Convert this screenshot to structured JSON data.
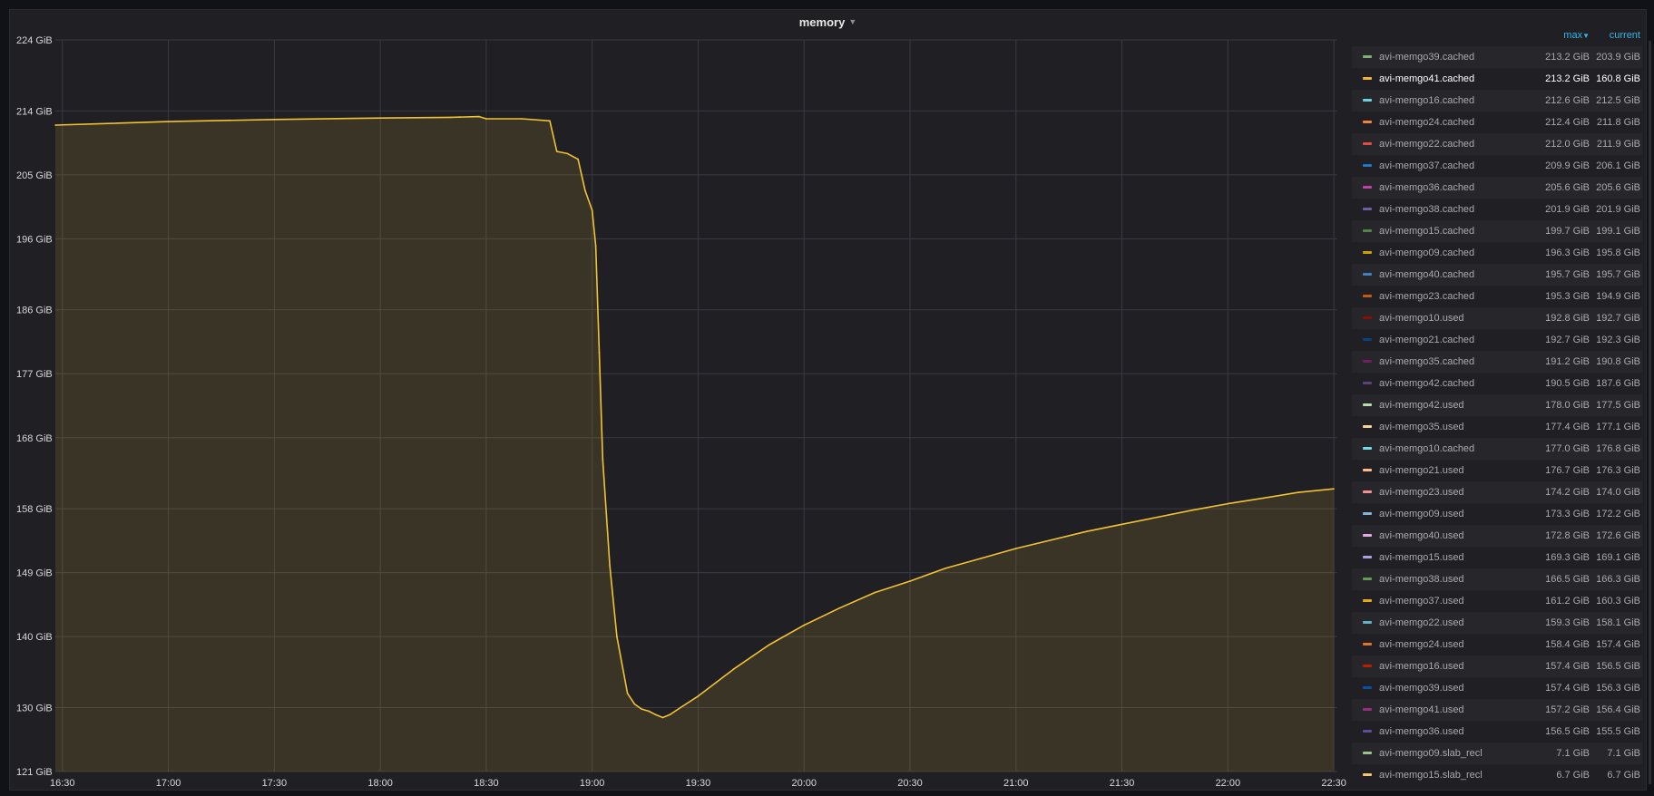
{
  "panel": {
    "title": "memory"
  },
  "chart_data": {
    "type": "area",
    "title": "memory",
    "y_unit": "GiB",
    "y_ticks": [
      "224 GiB",
      "214 GiB",
      "205 GiB",
      "196 GiB",
      "186 GiB",
      "177 GiB",
      "168 GiB",
      "158 GiB",
      "149 GiB",
      "140 GiB",
      "130 GiB",
      "121 GiB"
    ],
    "ylim": [
      121,
      224
    ],
    "x_ticks": [
      "16:30",
      "17:00",
      "17:30",
      "18:00",
      "18:30",
      "19:00",
      "19:30",
      "20:00",
      "20:30",
      "21:00",
      "21:30",
      "22:00",
      "22:30"
    ],
    "xlim_minutes": [
      988,
      1351
    ],
    "grid": true,
    "legend_placement": "right",
    "series": [
      {
        "name": "avi-memgo41.cached",
        "color": "#f2c233",
        "x": [
          "16:28",
          "17:00",
          "17:30",
          "18:00",
          "18:20",
          "18:28",
          "18:30",
          "18:40",
          "18:48",
          "18:50",
          "18:53",
          "18:56",
          "18:58",
          "19:00",
          "19:01",
          "19:02",
          "19:03",
          "19:05",
          "19:07",
          "19:10",
          "19:12",
          "19:14",
          "19:16",
          "19:18",
          "19:20",
          "19:22",
          "19:25",
          "19:30",
          "19:40",
          "19:50",
          "20:00",
          "20:10",
          "20:20",
          "20:30",
          "20:40",
          "20:50",
          "21:00",
          "21:10",
          "21:20",
          "21:30",
          "21:40",
          "21:50",
          "22:00",
          "22:10",
          "22:20",
          "22:30"
        ],
        "values": [
          212.0,
          212.5,
          212.8,
          213.0,
          213.1,
          213.2,
          212.9,
          212.9,
          212.6,
          208.3,
          208.0,
          207.2,
          202.8,
          200.0,
          195.0,
          180.0,
          165.0,
          150.0,
          140.0,
          132.0,
          130.5,
          129.8,
          129.5,
          129.0,
          128.6,
          129.0,
          130.0,
          131.6,
          135.4,
          138.8,
          141.6,
          144.0,
          146.2,
          147.8,
          149.6,
          151.0,
          152.4,
          153.6,
          154.8,
          155.8,
          156.8,
          157.8,
          158.7,
          159.5,
          160.3,
          160.8
        ]
      }
    ]
  },
  "legend": {
    "header": {
      "max_label": "max",
      "current_label": "current"
    },
    "rows": [
      {
        "name": "avi-memgo39.cached",
        "max": "213.2 GiB",
        "current": "203.9 GiB",
        "color": "#7eb26d"
      },
      {
        "name": "avi-memgo41.cached",
        "max": "213.2 GiB",
        "current": "160.8 GiB",
        "color": "#eab839",
        "selected": true
      },
      {
        "name": "avi-memgo16.cached",
        "max": "212.6 GiB",
        "current": "212.5 GiB",
        "color": "#6ed0e0"
      },
      {
        "name": "avi-memgo24.cached",
        "max": "212.4 GiB",
        "current": "211.8 GiB",
        "color": "#ef843c"
      },
      {
        "name": "avi-memgo22.cached",
        "max": "212.0 GiB",
        "current": "211.9 GiB",
        "color": "#e24d42"
      },
      {
        "name": "avi-memgo37.cached",
        "max": "209.9 GiB",
        "current": "206.1 GiB",
        "color": "#1f78c1"
      },
      {
        "name": "avi-memgo36.cached",
        "max": "205.6 GiB",
        "current": "205.6 GiB",
        "color": "#ba43a9"
      },
      {
        "name": "avi-memgo38.cached",
        "max": "201.9 GiB",
        "current": "201.9 GiB",
        "color": "#705da0"
      },
      {
        "name": "avi-memgo15.cached",
        "max": "199.7 GiB",
        "current": "199.1 GiB",
        "color": "#508642"
      },
      {
        "name": "avi-memgo09.cached",
        "max": "196.3 GiB",
        "current": "195.8 GiB",
        "color": "#cca300"
      },
      {
        "name": "avi-memgo40.cached",
        "max": "195.7 GiB",
        "current": "195.7 GiB",
        "color": "#447ebc"
      },
      {
        "name": "avi-memgo23.cached",
        "max": "195.3 GiB",
        "current": "194.9 GiB",
        "color": "#c15c17"
      },
      {
        "name": "avi-memgo10.used",
        "max": "192.8 GiB",
        "current": "192.7 GiB",
        "color": "#890f02"
      },
      {
        "name": "avi-memgo21.cached",
        "max": "192.7 GiB",
        "current": "192.3 GiB",
        "color": "#0a437c"
      },
      {
        "name": "avi-memgo35.cached",
        "max": "191.2 GiB",
        "current": "190.8 GiB",
        "color": "#6d1f62"
      },
      {
        "name": "avi-memgo42.cached",
        "max": "190.5 GiB",
        "current": "187.6 GiB",
        "color": "#584477"
      },
      {
        "name": "avi-memgo42.used",
        "max": "178.0 GiB",
        "current": "177.5 GiB",
        "color": "#b7dbab"
      },
      {
        "name": "avi-memgo35.used",
        "max": "177.4 GiB",
        "current": "177.1 GiB",
        "color": "#f4d598"
      },
      {
        "name": "avi-memgo10.cached",
        "max": "177.0 GiB",
        "current": "176.8 GiB",
        "color": "#70dbed"
      },
      {
        "name": "avi-memgo21.used",
        "max": "176.7 GiB",
        "current": "176.3 GiB",
        "color": "#f9ba8f"
      },
      {
        "name": "avi-memgo23.used",
        "max": "174.2 GiB",
        "current": "174.0 GiB",
        "color": "#f29191"
      },
      {
        "name": "avi-memgo09.used",
        "max": "173.3 GiB",
        "current": "172.2 GiB",
        "color": "#82b5d8"
      },
      {
        "name": "avi-memgo40.used",
        "max": "172.8 GiB",
        "current": "172.6 GiB",
        "color": "#e5a8e2"
      },
      {
        "name": "avi-memgo15.used",
        "max": "169.3 GiB",
        "current": "169.1 GiB",
        "color": "#aea2e0"
      },
      {
        "name": "avi-memgo38.used",
        "max": "166.5 GiB",
        "current": "166.3 GiB",
        "color": "#629e51"
      },
      {
        "name": "avi-memgo37.used",
        "max": "161.2 GiB",
        "current": "160.3 GiB",
        "color": "#e5ac0e"
      },
      {
        "name": "avi-memgo22.used",
        "max": "159.3 GiB",
        "current": "158.1 GiB",
        "color": "#64b0c8"
      },
      {
        "name": "avi-memgo24.used",
        "max": "158.4 GiB",
        "current": "157.4 GiB",
        "color": "#e0752d"
      },
      {
        "name": "avi-memgo16.used",
        "max": "157.4 GiB",
        "current": "156.5 GiB",
        "color": "#bf1b00"
      },
      {
        "name": "avi-memgo39.used",
        "max": "157.4 GiB",
        "current": "156.3 GiB",
        "color": "#0a50a1"
      },
      {
        "name": "avi-memgo41.used",
        "max": "157.2 GiB",
        "current": "156.4 GiB",
        "color": "#962d82"
      },
      {
        "name": "avi-memgo36.used",
        "max": "156.5 GiB",
        "current": "155.5 GiB",
        "color": "#614d93"
      },
      {
        "name": "avi-memgo09.slab_recl",
        "max": "7.1 GiB",
        "current": "7.1 GiB",
        "color": "#9ac48a"
      },
      {
        "name": "avi-memgo15.slab_recl",
        "max": "6.7 GiB",
        "current": "6.7 GiB",
        "color": "#f2c96d"
      }
    ]
  }
}
